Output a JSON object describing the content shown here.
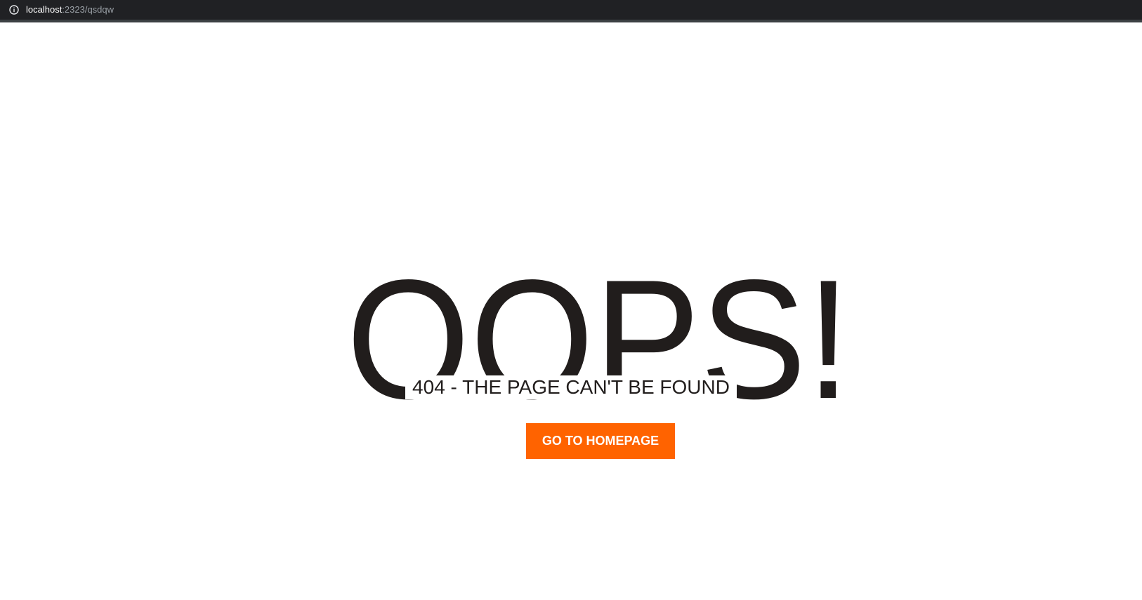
{
  "browser": {
    "url_host": "localhost",
    "url_rest": ":2323/qsdqw",
    "icon": "info-icon"
  },
  "page": {
    "headline": "OOPS!",
    "subtitle": "404 - THE PAGE CAN'T BE FOUND",
    "button_label": "GO TO HOMEPAGE"
  },
  "colors": {
    "address_bar_bg": "#202124",
    "headline": "#211d1c",
    "button_bg": "#ff6300",
    "button_text": "#ffffff"
  }
}
